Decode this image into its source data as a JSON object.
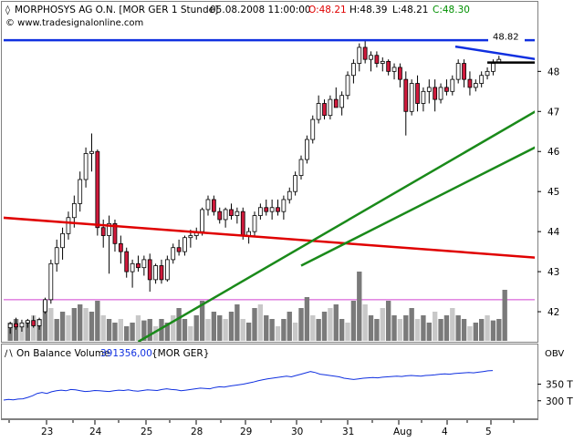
{
  "chart_data": [
    {
      "type": "candlestick",
      "header": {
        "symbol": "MORPHOSYS AG O.N. [MOR GER  1 Stunde]",
        "datetime": "05.08.2008 11:00:00",
        "open_label": "O:48.21",
        "high_label": "H:48.39",
        "low_label": "L:48.21",
        "close_label": "C:48.30",
        "watermark": "© www.tradesignalonline.com"
      },
      "price_label": "48.82",
      "ylim": [
        41.25,
        49.1
      ],
      "y_ticks": [
        "42",
        "43",
        "44",
        "45",
        "46",
        "47",
        "48"
      ],
      "x_ticks": [
        "23",
        "24",
        "25",
        "28",
        "29",
        "30",
        "31",
        "Aug",
        "4",
        "5"
      ],
      "colors": {
        "up": "#ffffff",
        "down": "#d01a3c",
        "wick": "#000000",
        "volume_dark": "#7a7a7a",
        "volume_light": "#c8c8c8",
        "red_line": "#e00000",
        "blue_line": "#1030e0",
        "green_line": "#1a8a1a",
        "black_line": "#000000",
        "magenta_line": "#d040d0"
      },
      "candles": [
        {
          "o": 41.6,
          "h": 41.75,
          "l": 41.45,
          "c": 41.7
        },
        {
          "o": 41.7,
          "h": 41.85,
          "l": 41.55,
          "c": 41.62
        },
        {
          "o": 41.62,
          "h": 41.8,
          "l": 41.5,
          "c": 41.72
        },
        {
          "o": 41.72,
          "h": 41.82,
          "l": 41.6,
          "c": 41.78
        },
        {
          "o": 41.78,
          "h": 41.9,
          "l": 41.6,
          "c": 41.65
        },
        {
          "o": 41.65,
          "h": 41.85,
          "l": 41.55,
          "c": 41.8
        },
        {
          "o": 42.0,
          "h": 42.35,
          "l": 41.95,
          "c": 42.3
        },
        {
          "o": 42.3,
          "h": 43.3,
          "l": 42.2,
          "c": 43.2
        },
        {
          "o": 43.2,
          "h": 43.8,
          "l": 43.0,
          "c": 43.6
        },
        {
          "o": 43.6,
          "h": 44.1,
          "l": 43.3,
          "c": 43.95
        },
        {
          "o": 43.95,
          "h": 44.5,
          "l": 43.8,
          "c": 44.35
        },
        {
          "o": 44.35,
          "h": 44.9,
          "l": 44.1,
          "c": 44.7
        },
        {
          "o": 44.7,
          "h": 45.5,
          "l": 44.5,
          "c": 45.3
        },
        {
          "o": 45.3,
          "h": 46.1,
          "l": 45.1,
          "c": 45.95
        },
        {
          "o": 45.95,
          "h": 46.45,
          "l": 45.5,
          "c": 46.0
        },
        {
          "o": 46.0,
          "h": 46.05,
          "l": 43.9,
          "c": 44.1
        },
        {
          "o": 44.1,
          "h": 44.3,
          "l": 43.6,
          "c": 43.9
        },
        {
          "o": 43.9,
          "h": 44.4,
          "l": 42.95,
          "c": 44.2
        },
        {
          "o": 44.2,
          "h": 44.3,
          "l": 43.5,
          "c": 43.7
        },
        {
          "o": 43.7,
          "h": 43.9,
          "l": 43.2,
          "c": 43.5
        },
        {
          "o": 43.5,
          "h": 43.6,
          "l": 42.85,
          "c": 43.0
        },
        {
          "o": 43.0,
          "h": 43.3,
          "l": 42.6,
          "c": 43.2
        },
        {
          "o": 43.2,
          "h": 43.4,
          "l": 43.0,
          "c": 43.1
        },
        {
          "o": 43.1,
          "h": 43.4,
          "l": 42.9,
          "c": 43.3
        },
        {
          "o": 43.3,
          "h": 43.45,
          "l": 42.5,
          "c": 42.8
        },
        {
          "o": 42.8,
          "h": 43.2,
          "l": 42.7,
          "c": 43.15
        },
        {
          "o": 43.15,
          "h": 43.3,
          "l": 42.7,
          "c": 42.8
        },
        {
          "o": 42.8,
          "h": 43.4,
          "l": 42.75,
          "c": 43.3
        },
        {
          "o": 43.3,
          "h": 43.7,
          "l": 43.2,
          "c": 43.6
        },
        {
          "o": 43.6,
          "h": 43.8,
          "l": 43.4,
          "c": 43.5
        },
        {
          "o": 43.5,
          "h": 43.9,
          "l": 43.4,
          "c": 43.85
        },
        {
          "o": 43.85,
          "h": 44.05,
          "l": 43.6,
          "c": 43.9
        },
        {
          "o": 43.9,
          "h": 44.1,
          "l": 43.8,
          "c": 44.0
        },
        {
          "o": 44.0,
          "h": 44.6,
          "l": 43.9,
          "c": 44.55
        },
        {
          "o": 44.55,
          "h": 44.9,
          "l": 44.4,
          "c": 44.8
        },
        {
          "o": 44.8,
          "h": 44.9,
          "l": 44.4,
          "c": 44.5
        },
        {
          "o": 44.5,
          "h": 44.6,
          "l": 44.2,
          "c": 44.3
        },
        {
          "o": 44.3,
          "h": 44.6,
          "l": 44.1,
          "c": 44.55
        },
        {
          "o": 44.55,
          "h": 44.7,
          "l": 44.3,
          "c": 44.4
        },
        {
          "o": 44.4,
          "h": 44.6,
          "l": 44.2,
          "c": 44.5
        },
        {
          "o": 44.5,
          "h": 44.6,
          "l": 43.8,
          "c": 43.9
        },
        {
          "o": 43.9,
          "h": 44.1,
          "l": 43.7,
          "c": 44.0
        },
        {
          "o": 44.0,
          "h": 44.5,
          "l": 43.9,
          "c": 44.4
        },
        {
          "o": 44.4,
          "h": 44.7,
          "l": 44.3,
          "c": 44.6
        },
        {
          "o": 44.6,
          "h": 44.8,
          "l": 44.4,
          "c": 44.5
        },
        {
          "o": 44.5,
          "h": 44.8,
          "l": 44.3,
          "c": 44.6
        },
        {
          "o": 44.6,
          "h": 44.8,
          "l": 44.4,
          "c": 44.5
        },
        {
          "o": 44.5,
          "h": 44.9,
          "l": 44.3,
          "c": 44.8
        },
        {
          "o": 44.8,
          "h": 45.1,
          "l": 44.7,
          "c": 45.0
        },
        {
          "o": 45.0,
          "h": 45.5,
          "l": 44.9,
          "c": 45.4
        },
        {
          "o": 45.4,
          "h": 45.9,
          "l": 45.3,
          "c": 45.8
        },
        {
          "o": 45.8,
          "h": 46.4,
          "l": 45.7,
          "c": 46.3
        },
        {
          "o": 46.3,
          "h": 46.9,
          "l": 46.2,
          "c": 46.8
        },
        {
          "o": 46.8,
          "h": 47.4,
          "l": 46.7,
          "c": 47.2
        },
        {
          "o": 47.2,
          "h": 47.3,
          "l": 46.8,
          "c": 46.9
        },
        {
          "o": 46.9,
          "h": 47.4,
          "l": 46.8,
          "c": 47.3
        },
        {
          "o": 47.3,
          "h": 47.6,
          "l": 47.1,
          "c": 47.1
        },
        {
          "o": 47.1,
          "h": 47.5,
          "l": 46.9,
          "c": 47.4
        },
        {
          "o": 47.4,
          "h": 48.0,
          "l": 47.3,
          "c": 47.9
        },
        {
          "o": 47.9,
          "h": 48.3,
          "l": 47.7,
          "c": 48.2
        },
        {
          "o": 48.2,
          "h": 48.7,
          "l": 48.0,
          "c": 48.6
        },
        {
          "o": 48.6,
          "h": 48.8,
          "l": 48.2,
          "c": 48.3
        },
        {
          "o": 48.3,
          "h": 48.5,
          "l": 48.0,
          "c": 48.4
        },
        {
          "o": 48.4,
          "h": 48.5,
          "l": 48.1,
          "c": 48.2
        },
        {
          "o": 48.2,
          "h": 48.35,
          "l": 48.0,
          "c": 48.25
        },
        {
          "o": 48.25,
          "h": 48.3,
          "l": 47.9,
          "c": 48.0
        },
        {
          "o": 48.0,
          "h": 48.2,
          "l": 47.8,
          "c": 48.1
        },
        {
          "o": 48.1,
          "h": 48.2,
          "l": 47.6,
          "c": 47.8
        },
        {
          "o": 47.8,
          "h": 48.0,
          "l": 46.4,
          "c": 47.0
        },
        {
          "o": 47.0,
          "h": 47.8,
          "l": 46.9,
          "c": 47.7
        },
        {
          "o": 47.7,
          "h": 47.9,
          "l": 47.0,
          "c": 47.2
        },
        {
          "o": 47.2,
          "h": 47.6,
          "l": 47.0,
          "c": 47.5
        },
        {
          "o": 47.5,
          "h": 47.8,
          "l": 47.2,
          "c": 47.6
        },
        {
          "o": 47.6,
          "h": 47.8,
          "l": 47.0,
          "c": 47.3
        },
        {
          "o": 47.3,
          "h": 47.7,
          "l": 47.2,
          "c": 47.6
        },
        {
          "o": 47.6,
          "h": 47.8,
          "l": 47.4,
          "c": 47.5
        },
        {
          "o": 47.5,
          "h": 47.9,
          "l": 47.4,
          "c": 47.8
        },
        {
          "o": 47.8,
          "h": 48.3,
          "l": 47.7,
          "c": 48.2
        },
        {
          "o": 48.2,
          "h": 48.3,
          "l": 47.6,
          "c": 47.8
        },
        {
          "o": 47.8,
          "h": 48.0,
          "l": 47.4,
          "c": 47.6
        },
        {
          "o": 47.6,
          "h": 47.8,
          "l": 47.5,
          "c": 47.7
        },
        {
          "o": 47.7,
          "h": 48.0,
          "l": 47.6,
          "c": 47.9
        },
        {
          "o": 47.9,
          "h": 48.1,
          "l": 47.8,
          "c": 48.0
        },
        {
          "o": 48.0,
          "h": 48.3,
          "l": 47.9,
          "c": 48.2
        },
        {
          "o": 48.21,
          "h": 48.39,
          "l": 48.21,
          "c": 48.3
        }
      ],
      "volume": [
        {
          "v": 0.25,
          "d": 1
        },
        {
          "v": 0.3,
          "d": 1
        },
        {
          "v": 0.2,
          "d": 0
        },
        {
          "v": 0.28,
          "d": 1
        },
        {
          "v": 0.35,
          "d": 0
        },
        {
          "v": 0.3,
          "d": 1
        },
        {
          "v": 0.55,
          "d": 1
        },
        {
          "v": 0.45,
          "d": 0
        },
        {
          "v": 0.3,
          "d": 1
        },
        {
          "v": 0.4,
          "d": 1
        },
        {
          "v": 0.35,
          "d": 0
        },
        {
          "v": 0.45,
          "d": 1
        },
        {
          "v": 0.5,
          "d": 1
        },
        {
          "v": 0.45,
          "d": 0
        },
        {
          "v": 0.4,
          "d": 1
        },
        {
          "v": 0.55,
          "d": 1
        },
        {
          "v": 0.35,
          "d": 0
        },
        {
          "v": 0.3,
          "d": 1
        },
        {
          "v": 0.25,
          "d": 1
        },
        {
          "v": 0.3,
          "d": 0
        },
        {
          "v": 0.2,
          "d": 1
        },
        {
          "v": 0.25,
          "d": 1
        },
        {
          "v": 0.35,
          "d": 0
        },
        {
          "v": 0.28,
          "d": 1
        },
        {
          "v": 0.3,
          "d": 1
        },
        {
          "v": 0.2,
          "d": 0
        },
        {
          "v": 0.3,
          "d": 1
        },
        {
          "v": 0.25,
          "d": 1
        },
        {
          "v": 0.35,
          "d": 0
        },
        {
          "v": 0.45,
          "d": 1
        },
        {
          "v": 0.3,
          "d": 1
        },
        {
          "v": 0.2,
          "d": 0
        },
        {
          "v": 0.35,
          "d": 1
        },
        {
          "v": 0.55,
          "d": 1
        },
        {
          "v": 0.3,
          "d": 0
        },
        {
          "v": 0.4,
          "d": 1
        },
        {
          "v": 0.35,
          "d": 1
        },
        {
          "v": 0.3,
          "d": 0
        },
        {
          "v": 0.4,
          "d": 1
        },
        {
          "v": 0.5,
          "d": 1
        },
        {
          "v": 0.3,
          "d": 0
        },
        {
          "v": 0.25,
          "d": 1
        },
        {
          "v": 0.45,
          "d": 1
        },
        {
          "v": 0.5,
          "d": 0
        },
        {
          "v": 0.35,
          "d": 1
        },
        {
          "v": 0.3,
          "d": 1
        },
        {
          "v": 0.2,
          "d": 0
        },
        {
          "v": 0.3,
          "d": 1
        },
        {
          "v": 0.4,
          "d": 1
        },
        {
          "v": 0.25,
          "d": 0
        },
        {
          "v": 0.45,
          "d": 1
        },
        {
          "v": 0.6,
          "d": 1
        },
        {
          "v": 0.35,
          "d": 0
        },
        {
          "v": 0.3,
          "d": 1
        },
        {
          "v": 0.4,
          "d": 1
        },
        {
          "v": 0.45,
          "d": 0
        },
        {
          "v": 0.5,
          "d": 1
        },
        {
          "v": 0.3,
          "d": 1
        },
        {
          "v": 0.25,
          "d": 0
        },
        {
          "v": 0.55,
          "d": 1
        },
        {
          "v": 0.95,
          "d": 1
        },
        {
          "v": 0.5,
          "d": 0
        },
        {
          "v": 0.35,
          "d": 1
        },
        {
          "v": 0.3,
          "d": 1
        },
        {
          "v": 0.45,
          "d": 0
        },
        {
          "v": 0.55,
          "d": 1
        },
        {
          "v": 0.35,
          "d": 1
        },
        {
          "v": 0.3,
          "d": 0
        },
        {
          "v": 0.35,
          "d": 1
        },
        {
          "v": 0.45,
          "d": 1
        },
        {
          "v": 0.3,
          "d": 0
        },
        {
          "v": 0.35,
          "d": 1
        },
        {
          "v": 0.25,
          "d": 1
        },
        {
          "v": 0.4,
          "d": 0
        },
        {
          "v": 0.3,
          "d": 1
        },
        {
          "v": 0.35,
          "d": 1
        },
        {
          "v": 0.45,
          "d": 0
        },
        {
          "v": 0.35,
          "d": 1
        },
        {
          "v": 0.3,
          "d": 1
        },
        {
          "v": 0.2,
          "d": 0
        },
        {
          "v": 0.25,
          "d": 1
        },
        {
          "v": 0.3,
          "d": 1
        },
        {
          "v": 0.35,
          "d": 0
        },
        {
          "v": 0.28,
          "d": 1
        },
        {
          "v": 0.3,
          "d": 1
        },
        {
          "v": 0.7,
          "d": 1
        }
      ],
      "trendlines": [
        {
          "name": "red",
          "color": "red_line",
          "p1": {
            "i": -1.5,
            "y": 44.35
          },
          "p2": {
            "i": 118,
            "y": 43.05
          },
          "width": 2.5
        },
        {
          "name": "blue-top",
          "color": "blue_line",
          "p1": {
            "i": -1.5,
            "y": 48.78
          },
          "p2": {
            "i": 113,
            "y": 48.78
          },
          "width": 2.5
        },
        {
          "name": "blue-wedge",
          "color": "blue_line",
          "p1": {
            "i": 76.5,
            "y": 48.62
          },
          "p2": {
            "i": 112.5,
            "y": 47.8
          },
          "width": 2.5
        },
        {
          "name": "black",
          "color": "black_line",
          "p1": {
            "i": 82,
            "y": 48.22
          },
          "p2": {
            "i": 112.5,
            "y": 48.22
          },
          "width": 2.5
        },
        {
          "name": "green-1",
          "color": "green_line",
          "p1": {
            "i": 22,
            "y": 41.25
          },
          "p2": {
            "i": 114,
            "y": 49.0
          },
          "width": 2.5
        },
        {
          "name": "green-2",
          "color": "green_line",
          "p1": {
            "i": 50,
            "y": 43.15
          },
          "p2": {
            "i": 114,
            "y": 47.85
          },
          "width": 2.5
        }
      ],
      "magenta_level": 42.3
    },
    {
      "type": "line",
      "label": "On Balance Volume",
      "value_label": "391356,00",
      "symbol_label": "{MOR GER}",
      "axis_label": "OBV",
      "y_ticks": [
        "350 T",
        "300 T"
      ],
      "ylim": [
        250,
        420
      ],
      "color": "#1030e0",
      "values": [
        302,
        304,
        303,
        305,
        306,
        310,
        315,
        322,
        325,
        322,
        327,
        330,
        332,
        330,
        334,
        333,
        330,
        328,
        329,
        331,
        330,
        329,
        328,
        330,
        332,
        331,
        333,
        330,
        329,
        331,
        333,
        332,
        331,
        334,
        336,
        334,
        333,
        330,
        332,
        334,
        336,
        338,
        337,
        336,
        340,
        342,
        341,
        344,
        346,
        348,
        350,
        353,
        356,
        360,
        363,
        366,
        368,
        370,
        372,
        374,
        372,
        376,
        380,
        384,
        388,
        385,
        380,
        378,
        376,
        374,
        372,
        368,
        366,
        364,
        366,
        368,
        369,
        370,
        369,
        371,
        372,
        373,
        374,
        373,
        375,
        376,
        375,
        374,
        376,
        377,
        378,
        380,
        381,
        380,
        382,
        383,
        384,
        385,
        384,
        386,
        388,
        390,
        391
      ]
    }
  ]
}
